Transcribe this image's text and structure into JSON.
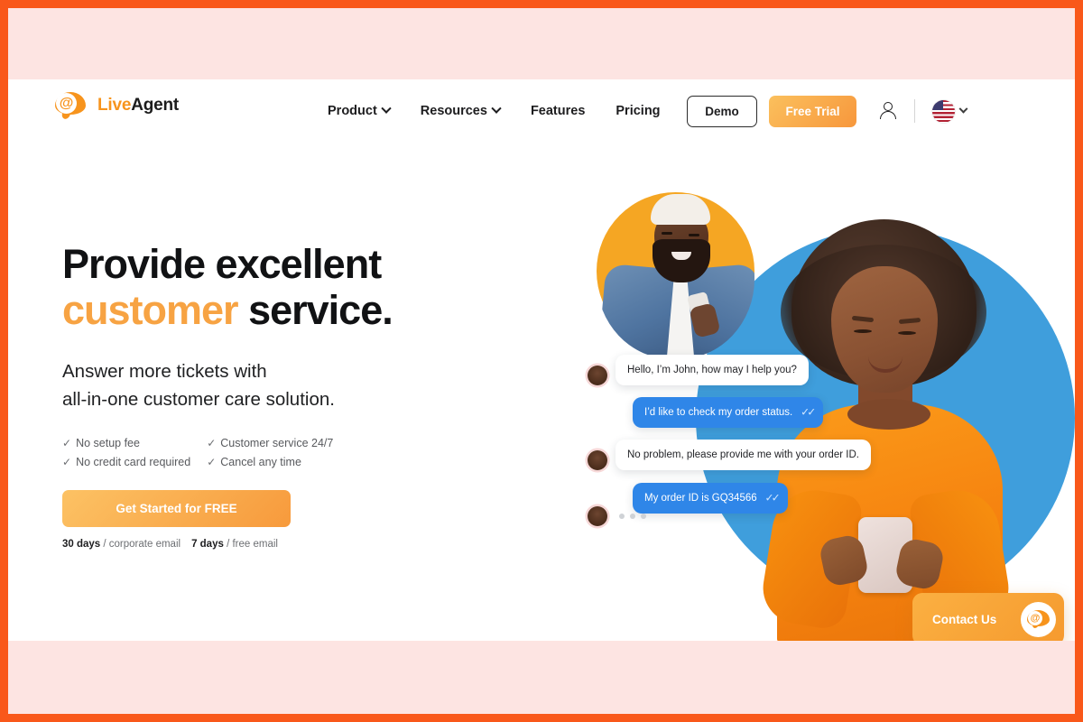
{
  "brand": {
    "logo_live": "Live",
    "logo_agent": "Agent",
    "logo_icon": "at-speech-bubble-icon",
    "accent_orange": "#F7941D",
    "border_orange": "#F9581A",
    "band_pink": "#FDE4E2",
    "chat_blue": "#2F86E8",
    "circle_blue": "#3F9EDC",
    "circle_orange": "#F5A623"
  },
  "nav": {
    "items": [
      {
        "label": "Product",
        "has_dropdown": true
      },
      {
        "label": "Resources",
        "has_dropdown": true
      },
      {
        "label": "Features",
        "has_dropdown": false
      },
      {
        "label": "Pricing",
        "has_dropdown": false
      }
    ],
    "demo_label": "Demo",
    "free_trial_label": "Free Trial",
    "account_icon": "user-account-icon",
    "language": "US",
    "language_icon": "us-flag-icon"
  },
  "hero": {
    "headline_line1": "Provide excellent",
    "headline_highlight": "customer",
    "headline_rest": " service.",
    "subhead_line1": "Answer more tickets with",
    "subhead_line2": "all-in-one customer care solution.",
    "features": [
      "No setup fee",
      "Customer service 24/7",
      "No credit card required",
      "Cancel any time"
    ],
    "tick_glyph": "✓",
    "cta_label": "Get Started for FREE",
    "trial_note": {
      "days_corporate": "30 days",
      "corporate_text": " / corporate email",
      "days_free": "7 days",
      "free_text": " / free email"
    }
  },
  "chat": {
    "messages": [
      {
        "from": "agent",
        "text": "Hello, I’m John, how may I help you?",
        "read": false
      },
      {
        "from": "customer",
        "text": "I’d like to check my order status.",
        "read": true
      },
      {
        "from": "agent",
        "text": "No problem, please provide me with your order ID.",
        "read": false
      },
      {
        "from": "customer",
        "text": "My order ID is GQ34566",
        "read": true
      }
    ],
    "typing_indicator": true,
    "read_glyph": "✓✓"
  },
  "contact_widget": {
    "label": "Contact Us",
    "icon": "at-speech-bubble-icon"
  }
}
